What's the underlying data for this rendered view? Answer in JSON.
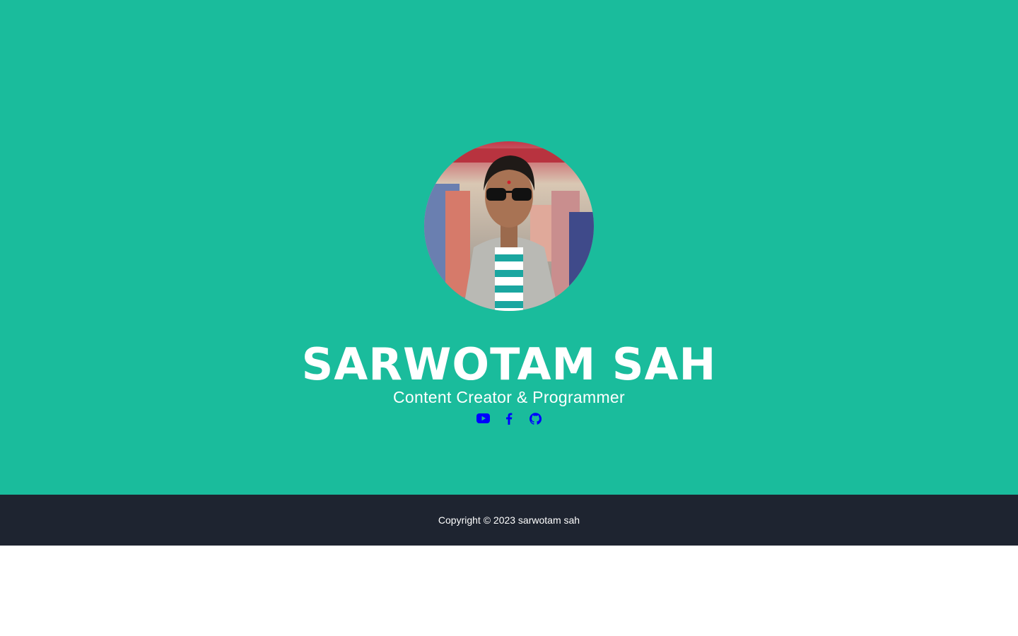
{
  "profile": {
    "name": "SARWOTAM SAH",
    "subtitle": "Content Creator & Programmer",
    "avatar": "profile-photo"
  },
  "socials": [
    {
      "icon": "youtube-icon",
      "color": "#0000ff"
    },
    {
      "icon": "facebook-icon",
      "color": "#0000ff"
    },
    {
      "icon": "github-icon",
      "color": "#0000ff"
    }
  ],
  "footer": {
    "copyright": "Copyright © 2023 sarwotam sah"
  },
  "colors": {
    "hero_background": "#1abc9c",
    "footer_background": "#1e2430",
    "text": "#ffffff",
    "icon": "#0000ff"
  }
}
